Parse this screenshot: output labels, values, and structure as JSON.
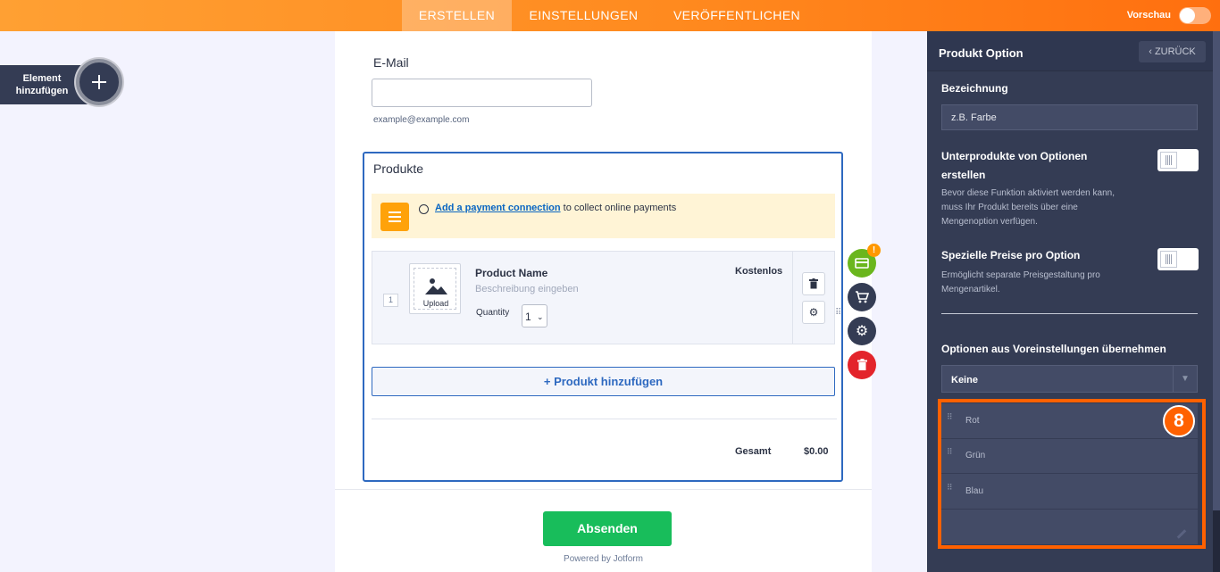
{
  "topbar": {
    "tabs": [
      {
        "label": "ERSTELLEN"
      },
      {
        "label": "EINSTELLUNGEN"
      },
      {
        "label": "VERÖFFENTLICHEN"
      }
    ],
    "preview_label": "Vorschau"
  },
  "sidebar_left": {
    "add_element_label": "Element hinzufügen"
  },
  "form": {
    "email": {
      "label": "E-Mail",
      "value": "",
      "sublabel": "example@example.com"
    },
    "products": {
      "title": "Produkte",
      "notice_link": "Add a payment connection",
      "notice_text": "to collect online payments",
      "items": [
        {
          "number": "1",
          "upload_label": "Upload",
          "name": "Product Name",
          "description_placeholder": "Beschreibung eingeben",
          "quantity_label": "Quantity",
          "quantity_value": "1",
          "price": "Kostenlos"
        }
      ],
      "add_product_label": "+ Produkt hinzufügen",
      "total_label": "Gesamt",
      "total_value": "$0.00"
    },
    "submit_label": "Absenden",
    "powered_by": "Powered by Jotform"
  },
  "side_tools": {
    "badge": "!"
  },
  "panel": {
    "title": "Produkt Option",
    "back_label": "ZURÜCK",
    "name_label": "Bezeichnung",
    "name_value": "z.B. Farbe",
    "subproducts_label": "Unterprodukte von Optionen erstellen",
    "subproducts_desc": "Bevor diese Funktion aktiviert werden kann, muss Ihr Produkt bereits über eine Mengenoption verfügen.",
    "special_prices_label": "Spezielle Preise pro Option",
    "special_prices_desc": "Ermöglicht separate Preisgestaltung pro Mengenartikel.",
    "preset_label": "Optionen aus Voreinstellungen übernehmen",
    "preset_value": "Keine",
    "options": [
      {
        "label": "Rot"
      },
      {
        "label": "Grün"
      },
      {
        "label": "Blau"
      }
    ]
  },
  "annotation": {
    "step_number": "8",
    "accent_color": "#ff6100"
  }
}
